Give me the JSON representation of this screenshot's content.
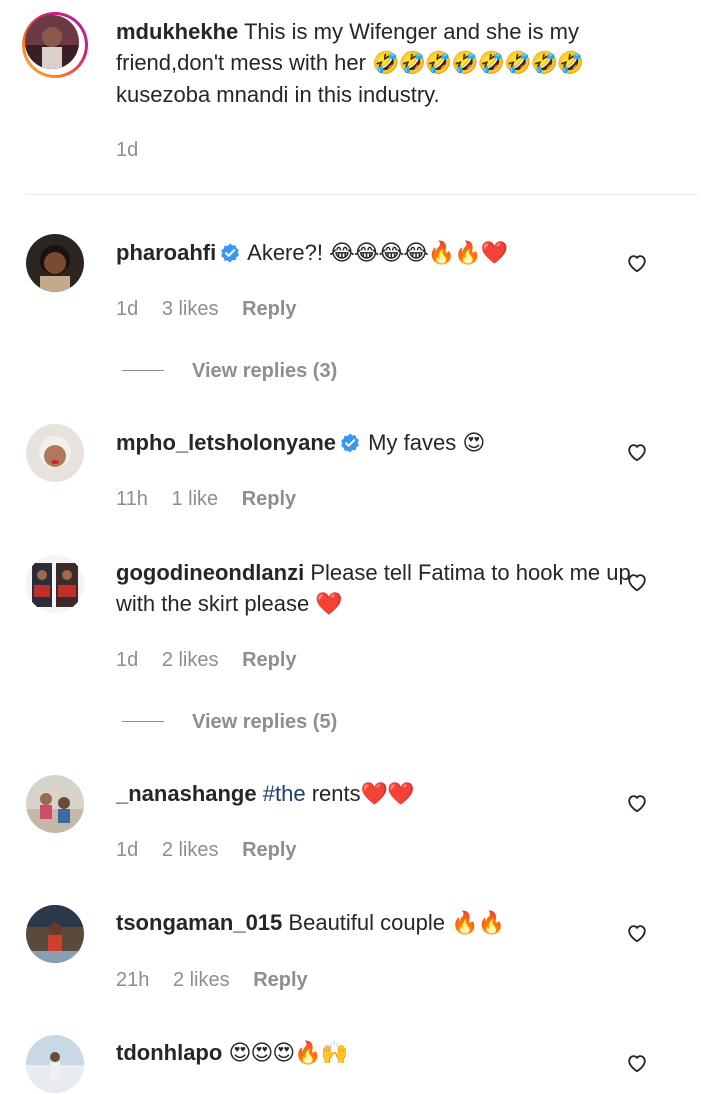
{
  "caption": {
    "username": "mdukhekhe",
    "text": "This is my Wifenger and she is my friend,don't mess with her",
    "emojis": "🤣🤣🤣🤣🤣🤣🤣🤣",
    "text2": "kusezoba mnandi in this industry.",
    "time": "1d"
  },
  "comments": [
    {
      "username": "pharoahfi",
      "verified": true,
      "text": "Akere?!",
      "emojis": "😂😂😂😂🔥🔥❤️",
      "time": "1d",
      "likes": "3 likes",
      "reply": "Reply",
      "view_replies": "View replies (3)"
    },
    {
      "username": "mpho_letsholonyane",
      "verified": true,
      "text": "My faves",
      "emojis": "😍",
      "time": "11h",
      "likes": "1 like",
      "reply": "Reply"
    },
    {
      "username": "gogodineondlanzi",
      "text": "Please tell Fatima to hook me up with the skirt please",
      "emojis": "❤️",
      "time": "1d",
      "likes": "2 likes",
      "reply": "Reply",
      "view_replies": "View replies (5)"
    },
    {
      "username": "_nanashange",
      "hashtag": "#the",
      "text": "rents",
      "emojis": "❤️❤️",
      "time": "1d",
      "likes": "2 likes",
      "reply": "Reply"
    },
    {
      "username": "tsongaman_015",
      "text": "Beautiful couple",
      "emojis": "🔥🔥",
      "time": "21h",
      "likes": "2 likes",
      "reply": "Reply"
    },
    {
      "username": "tdonhlapo",
      "emojis": "😍😍😍🔥🙌"
    }
  ],
  "icons": {
    "heart": "heart-outline-icon",
    "verified": "verified-badge-icon"
  },
  "colors": {
    "verified": "#3897f0",
    "hashtag": "#1c3d6e",
    "meta": "#8e8e8e",
    "text": "#262626",
    "story_ring": "#d81f74"
  }
}
